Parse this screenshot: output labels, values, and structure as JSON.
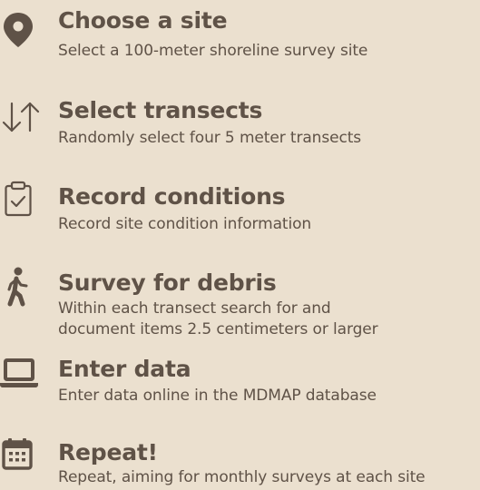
{
  "colors": {
    "background": "#ebe0cf",
    "text": "#5f5247"
  },
  "steps": [
    {
      "icon": "map-pin-icon",
      "title": "Choose a site",
      "description": [
        "Select a 100-meter shoreline survey site"
      ]
    },
    {
      "icon": "up-down-arrows-icon",
      "title": "Select transects",
      "description": [
        "Randomly select four 5 meter transects"
      ]
    },
    {
      "icon": "clipboard-check-icon",
      "title": "Record conditions",
      "description": [
        "Record site condition information"
      ]
    },
    {
      "icon": "walking-person-icon",
      "title": "Survey for debris",
      "description": [
        "Within each transect search for and",
        "document items 2.5 centimeters or larger"
      ]
    },
    {
      "icon": "laptop-icon",
      "title": "Enter data",
      "description": [
        "Enter data online in the MDMAP database"
      ]
    },
    {
      "icon": "calendar-icon",
      "title": "Repeat!",
      "description": [
        "Repeat, aiming for monthly surveys at each site"
      ]
    }
  ]
}
